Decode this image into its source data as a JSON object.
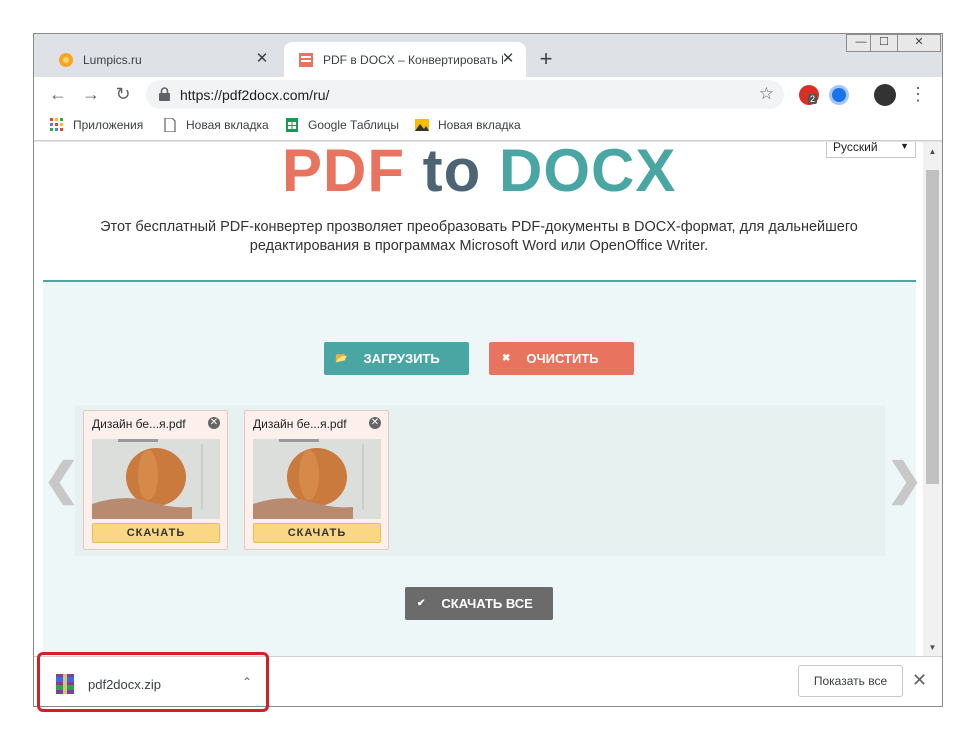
{
  "tabs": [
    {
      "title": "Lumpics.ru",
      "close": "✕"
    },
    {
      "title": "PDF в DOCX – Конвертировать PDF в DOCX онлайн",
      "close": "✕"
    }
  ],
  "new_tab": "+",
  "window_controls": {
    "minimize": "—",
    "maximize": "☐",
    "close": "✕"
  },
  "toolbar": {
    "back": "←",
    "forward": "→",
    "reload": "↻",
    "url": "https://pdf2docx.com/ru/",
    "star": "☆",
    "ext_badge": "2",
    "menu": "⋮"
  },
  "bookmarks": [
    {
      "label": "Приложения"
    },
    {
      "label": "Новая вкладка"
    },
    {
      "label": "Google Таблицы"
    },
    {
      "label": "Новая вкладка"
    }
  ],
  "page": {
    "logo": {
      "part1": "PDF ",
      "part2": "t",
      "part3": "o",
      "part4": " DOCX"
    },
    "language": "Русский",
    "description": "Этот бесплатный PDF-конвертер прозволяет преобразовать PDF-документы в DOCX-формат, для дальнейшего редактирования в программах Microsoft Word или OpenOffice Writer.",
    "upload_label": "ЗАГРУЗИТЬ",
    "clear_label": "ОЧИСТИТЬ",
    "prev": "❮",
    "next": "❯",
    "files": [
      {
        "name": "Дизайн бе...я.pdf",
        "download": "СКАЧАТЬ"
      },
      {
        "name": "Дизайн бе...я.pdf",
        "download": "СКАЧАТЬ"
      }
    ],
    "download_all_label": "СКАЧАТЬ ВСЕ"
  },
  "downloads": {
    "file": "pdf2docx.zip",
    "chevron": "⌃",
    "show_all": "Показать все",
    "close": "✕"
  },
  "colors": {
    "teal": "#4aa6a3",
    "coral": "#e8735f",
    "slate": "#4d6475",
    "highlight": "#d0202a"
  }
}
